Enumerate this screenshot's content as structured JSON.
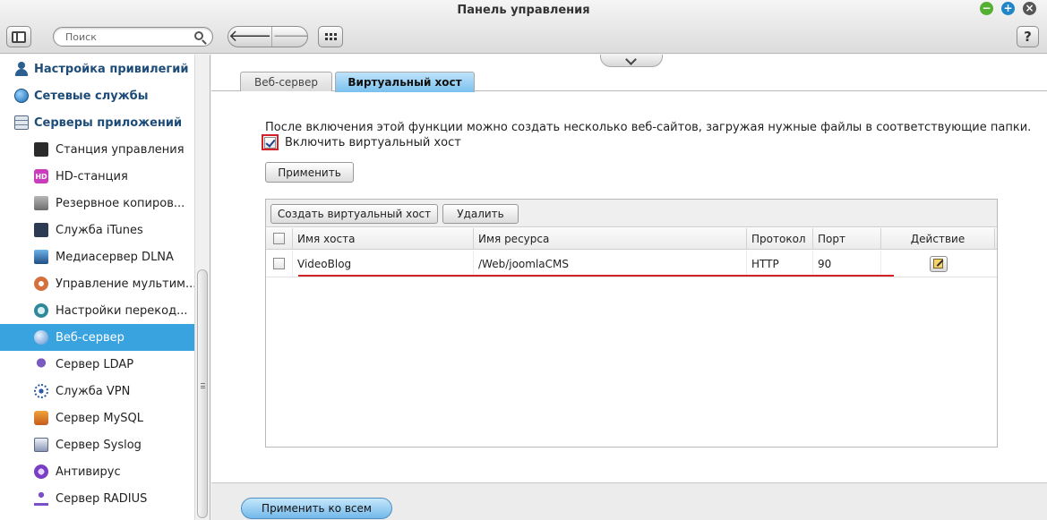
{
  "window": {
    "title": "Панель управления"
  },
  "toolbar": {
    "search_placeholder": "Поиск",
    "back_label": "🡐",
    "forward_label": "🡒",
    "help_label": "?"
  },
  "sidebar": {
    "categories": [
      {
        "label": "Настройка привилегий",
        "icon": "person-icon"
      },
      {
        "label": "Сетевые службы",
        "icon": "globe-icon"
      },
      {
        "label": "Серверы приложений",
        "icon": "server-icon"
      }
    ],
    "items": [
      {
        "label": "Станция управления",
        "icon": "surveillance-station-icon"
      },
      {
        "label": "HD-станция",
        "icon": "hd-station-icon",
        "icon_text": "HD"
      },
      {
        "label": "Резервное копиров...",
        "icon": "backup-icon"
      },
      {
        "label": "Служба iTunes",
        "icon": "itunes-icon"
      },
      {
        "label": "Медиасервер DLNA",
        "icon": "dlna-icon"
      },
      {
        "label": "Управление мультим...",
        "icon": "multimedia-icon"
      },
      {
        "label": "Настройки перекод...",
        "icon": "transcode-icon"
      },
      {
        "label": "Веб-сервер",
        "icon": "web-server-icon",
        "active": true
      },
      {
        "label": "Сервер LDAP",
        "icon": "ldap-icon"
      },
      {
        "label": "Служба VPN",
        "icon": "vpn-icon"
      },
      {
        "label": "Сервер MySQL",
        "icon": "mysql-icon"
      },
      {
        "label": "Сервер Syslog",
        "icon": "syslog-icon"
      },
      {
        "label": "Антивирус",
        "icon": "antivirus-icon"
      },
      {
        "label": "Сервер RADIUS",
        "icon": "radius-icon"
      }
    ]
  },
  "tabs": [
    {
      "label": "Веб-сервер",
      "active": false
    },
    {
      "label": "Виртуальный хост",
      "active": true
    }
  ],
  "vhost": {
    "description": "После включения этой функции можно создать несколько веб-сайтов, загружая нужные файлы в соответствующие папки.",
    "enable_label": "Включить виртуальный хост",
    "enable_checked": true,
    "apply_label": "Применить",
    "create_label": "Создать виртуальный хост",
    "delete_label": "Удалить",
    "columns": [
      "Имя хоста",
      "Имя ресурса",
      "Протокол",
      "Порт",
      "Действие"
    ],
    "rows": [
      {
        "host": "VideoBlog",
        "resource": "/Web/joomlaCMS",
        "protocol": "HTTP",
        "port": "90"
      }
    ]
  },
  "footer": {
    "apply_all_label": "Применить ко всем"
  },
  "colors": {
    "accent": "#39a3e0",
    "annotation_red": "#d42027",
    "category_text": "#1e4c78"
  }
}
